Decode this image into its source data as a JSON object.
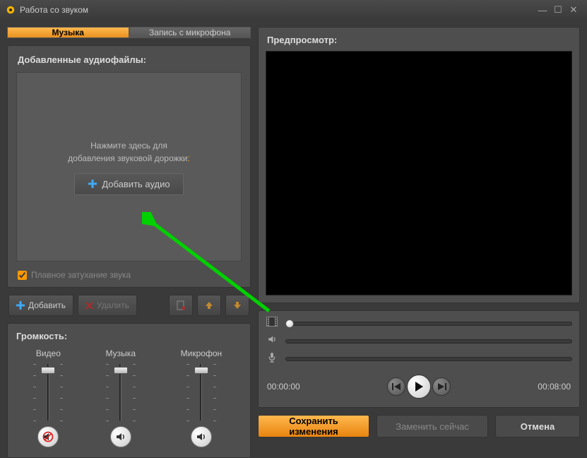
{
  "window": {
    "title": "Работа со звуком"
  },
  "tabs": {
    "music": "Музыка",
    "mic": "Запись с микрофона"
  },
  "files": {
    "title": "Добавленные аудиофайлы:",
    "hint_line1": "Нажмите здесь для",
    "hint_line2": "добавления звуковой дорожки",
    "add_btn": "Добавить аудио",
    "fade": "Плавное затухание звука"
  },
  "toolbar": {
    "add": "Добавить",
    "delete": "Удалить"
  },
  "volume": {
    "title": "Громкость:",
    "video": "Видео",
    "music": "Музыка",
    "mic": "Микрофон"
  },
  "preview": {
    "title": "Предпросмотр:"
  },
  "time": {
    "current": "00:00:00",
    "total": "00:08:00"
  },
  "buttons": {
    "save": "Сохранить изменения",
    "replace": "Заменить сейчас",
    "cancel": "Отмена"
  }
}
